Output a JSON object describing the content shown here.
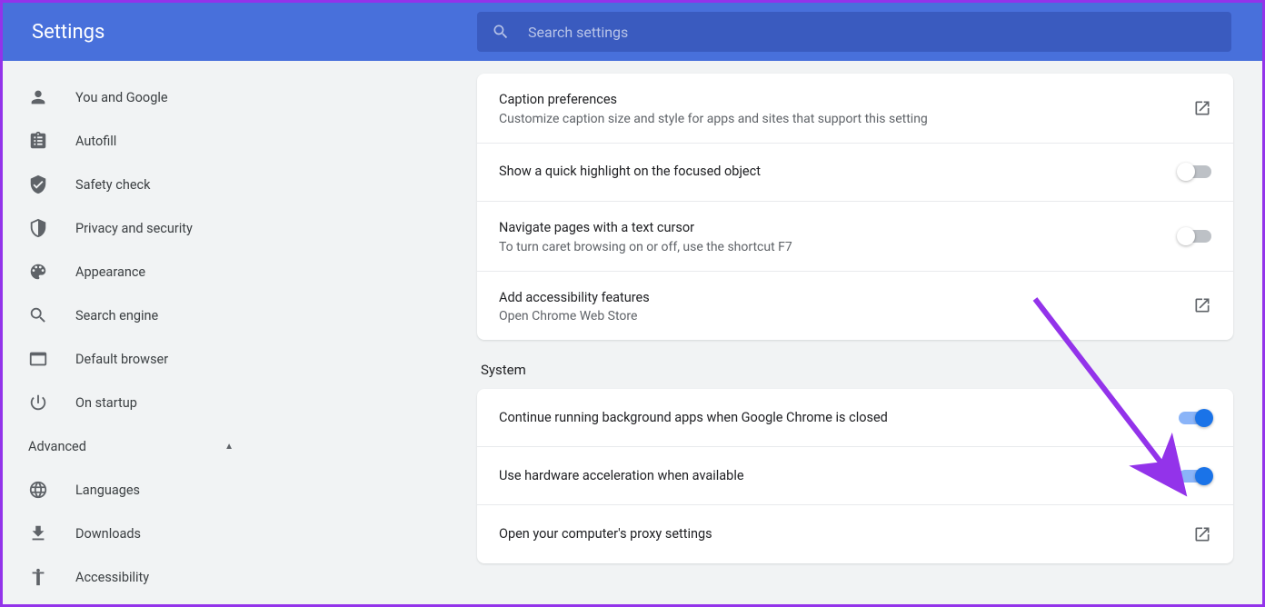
{
  "header": {
    "title": "Settings",
    "search_placeholder": "Search settings"
  },
  "sidebar": {
    "items": [
      {
        "icon": "person",
        "label": "You and Google"
      },
      {
        "icon": "assignment",
        "label": "Autofill"
      },
      {
        "icon": "shield-check",
        "label": "Safety check"
      },
      {
        "icon": "shield",
        "label": "Privacy and security"
      },
      {
        "icon": "palette",
        "label": "Appearance"
      },
      {
        "icon": "search",
        "label": "Search engine"
      },
      {
        "icon": "browser",
        "label": "Default browser"
      },
      {
        "icon": "power",
        "label": "On startup"
      }
    ],
    "advanced_label": "Advanced",
    "advanced_items": [
      {
        "icon": "globe",
        "label": "Languages"
      },
      {
        "icon": "download",
        "label": "Downloads"
      },
      {
        "icon": "accessibility",
        "label": "Accessibility"
      }
    ]
  },
  "main": {
    "accessibility_rows": [
      {
        "title": "Caption preferences",
        "sub": "Customize caption size and style for apps and sites that support this setting",
        "action": "launch"
      },
      {
        "title": "Show a quick highlight on the focused object",
        "action": "toggle",
        "on": false
      },
      {
        "title": "Navigate pages with a text cursor",
        "sub": "To turn caret browsing on or off, use the shortcut F7",
        "action": "toggle",
        "on": false
      },
      {
        "title": "Add accessibility features",
        "sub": "Open Chrome Web Store",
        "action": "launch"
      }
    ],
    "system_title": "System",
    "system_rows": [
      {
        "title": "Continue running background apps when Google Chrome is closed",
        "action": "toggle",
        "on": true
      },
      {
        "title": "Use hardware acceleration when available",
        "action": "toggle",
        "on": true
      },
      {
        "title": "Open your computer's proxy settings",
        "action": "launch"
      }
    ]
  }
}
